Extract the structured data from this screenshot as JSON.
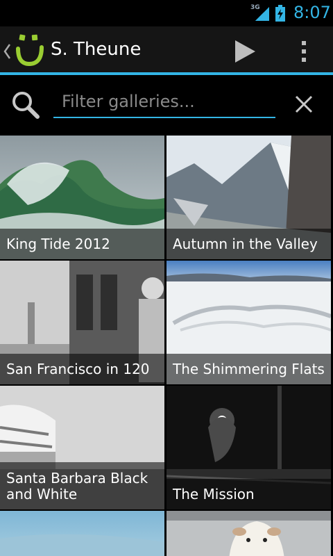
{
  "status_bar": {
    "network": "3G",
    "time": "8:07"
  },
  "action_bar": {
    "title": "S. Theune",
    "accent_color": "#33b5e5",
    "logo_color": "#9acd32"
  },
  "filter": {
    "placeholder": "Filter galleries...",
    "value": ""
  },
  "galleries": [
    {
      "title": "King Tide 2012"
    },
    {
      "title": "Autumn in the Valley"
    },
    {
      "title": "San Francisco in 120"
    },
    {
      "title": "The Shimmering Flats"
    },
    {
      "title": "Santa Barbara Black and White"
    },
    {
      "title": "The Mission"
    },
    {
      "title": ""
    },
    {
      "title": ""
    }
  ]
}
